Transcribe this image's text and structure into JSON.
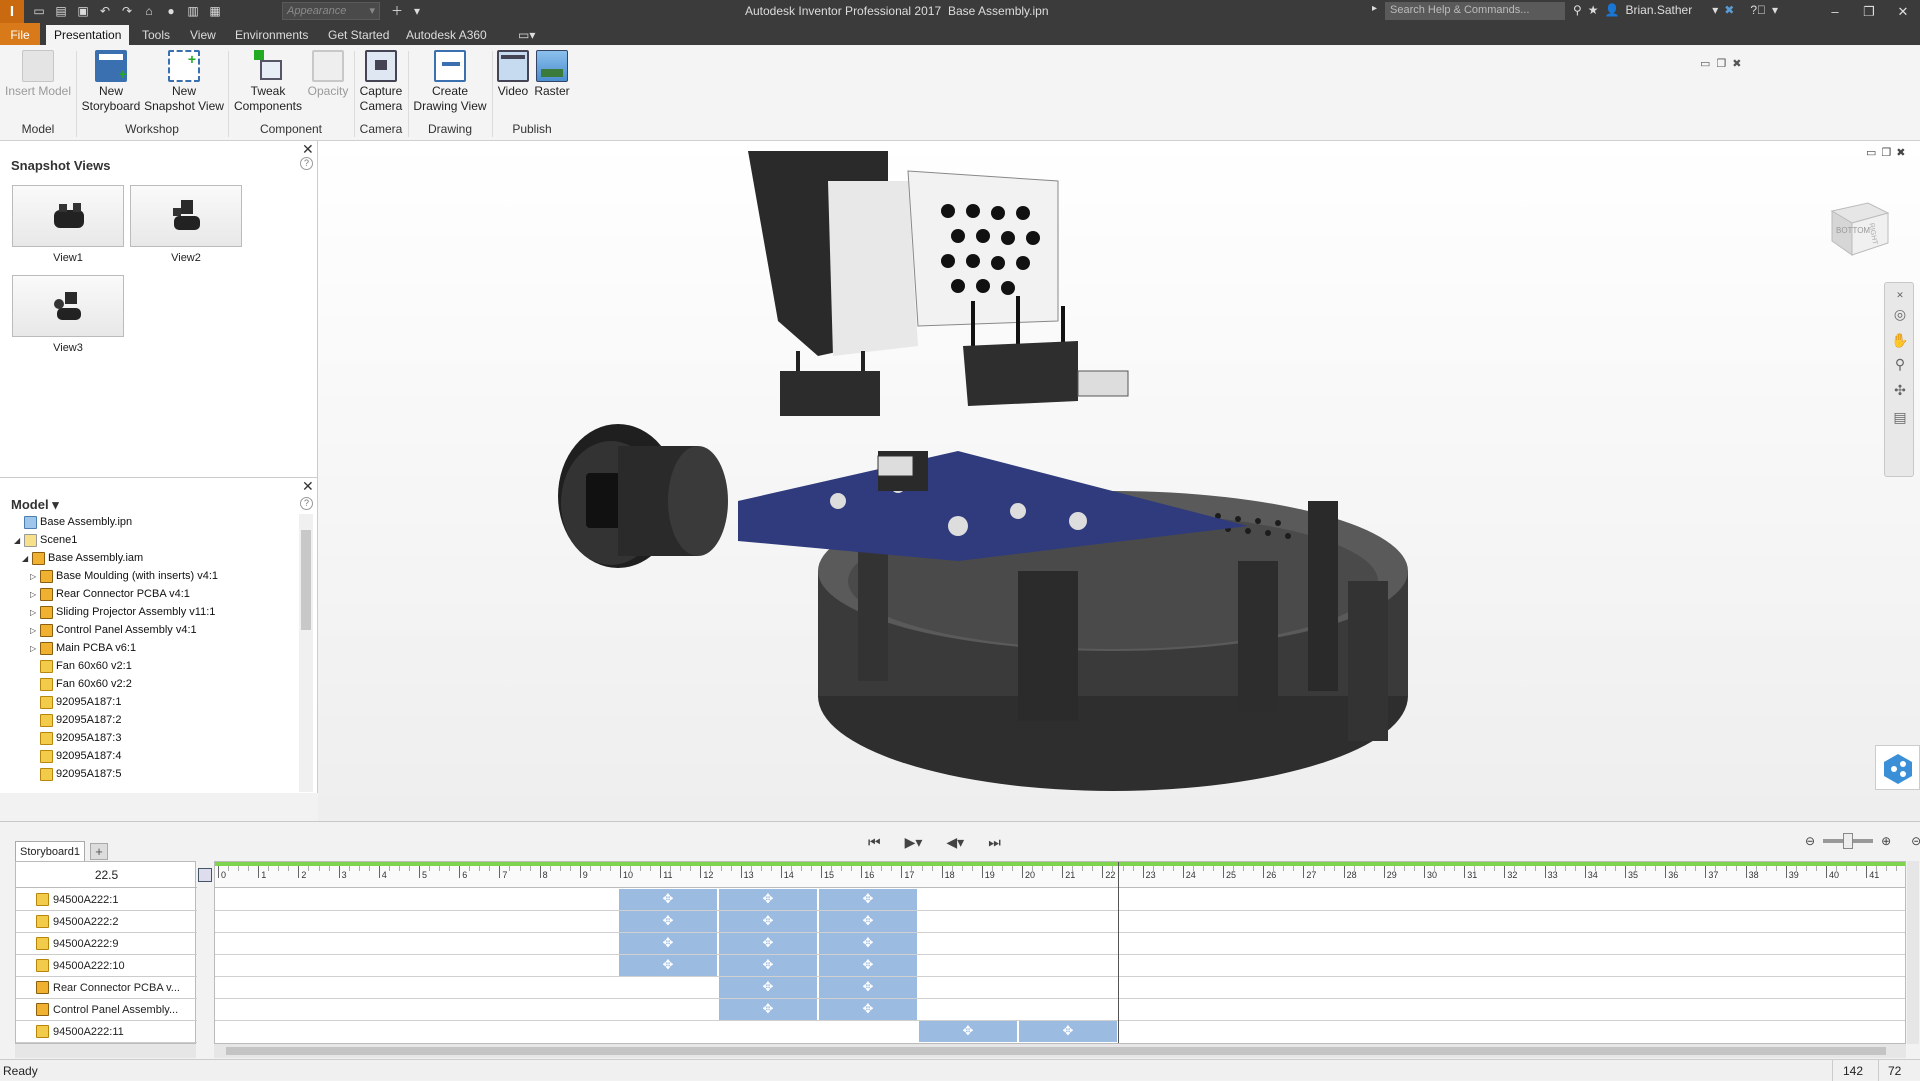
{
  "titlebar": {
    "app_title": "Autodesk Inventor Professional 2017",
    "file_name": "Base Assembly.ipn",
    "appearance_placeholder": "Appearance",
    "search_placeholder": "Search Help & Commands...",
    "user": "Brian.Sather"
  },
  "menu": {
    "tabs": [
      "File",
      "Presentation",
      "Tools",
      "View",
      "Environments",
      "Get Started",
      "Autodesk A360"
    ]
  },
  "ribbon": {
    "buttons": {
      "insert_model": "Insert Model",
      "new_storyboard_1": "New",
      "new_storyboard_2": "Storyboard",
      "new_snapshot_1": "New",
      "new_snapshot_2": "Snapshot View",
      "tweak_1": "Tweak",
      "tweak_2": "Components",
      "opacity": "Opacity",
      "capture_1": "Capture",
      "capture_2": "Camera",
      "drawing_1": "Create",
      "drawing_2": "Drawing View",
      "video": "Video",
      "raster": "Raster"
    },
    "groups": [
      "Model",
      "Workshop",
      "Component",
      "Camera",
      "Drawing",
      "Publish"
    ]
  },
  "snapshot_panel": {
    "title": "Snapshot Views",
    "views": [
      "View1",
      "View2",
      "View3"
    ]
  },
  "model_panel": {
    "title": "Model",
    "tree": [
      "Base Assembly.ipn",
      "Scene1",
      "Base Assembly.iam",
      "Base Moulding (with inserts) v4:1",
      "Rear Connector PCBA v4:1",
      "Sliding Projector Assembly v11:1",
      "Control Panel Assembly v4:1",
      "Main PCBA v6:1",
      "Fan 60x60 v2:1",
      "Fan 60x60 v2:2",
      "92095A187:1",
      "92095A187:2",
      "92095A187:3",
      "92095A187:4",
      "92095A187:5"
    ]
  },
  "viewcube": {
    "face_right": "RIGHT",
    "face_bottom": "BOTTOM"
  },
  "storyboard": {
    "tab": "Storyboard1",
    "add_tab": "+",
    "current_time": "22.5",
    "rows": [
      "94500A222:1",
      "94500A222:2",
      "94500A222:9",
      "94500A222:10",
      "Rear Connector PCBA v...",
      "Control Panel Assembly...",
      "94500A222:11"
    ],
    "ruler_labels": [
      "0",
      "1",
      "2",
      "3",
      "4",
      "5",
      "6",
      "7",
      "8",
      "9",
      "10",
      "11",
      "12",
      "13",
      "14",
      "15",
      "16",
      "17",
      "18",
      "19",
      "20",
      "21",
      "22",
      "23",
      "24",
      "25",
      "26",
      "27",
      "28",
      "29",
      "30",
      "31",
      "32",
      "33",
      "34",
      "35",
      "36",
      "37",
      "38",
      "39",
      "40",
      "41"
    ]
  },
  "status": {
    "text": "Ready",
    "n1": "142",
    "n2": "72"
  }
}
